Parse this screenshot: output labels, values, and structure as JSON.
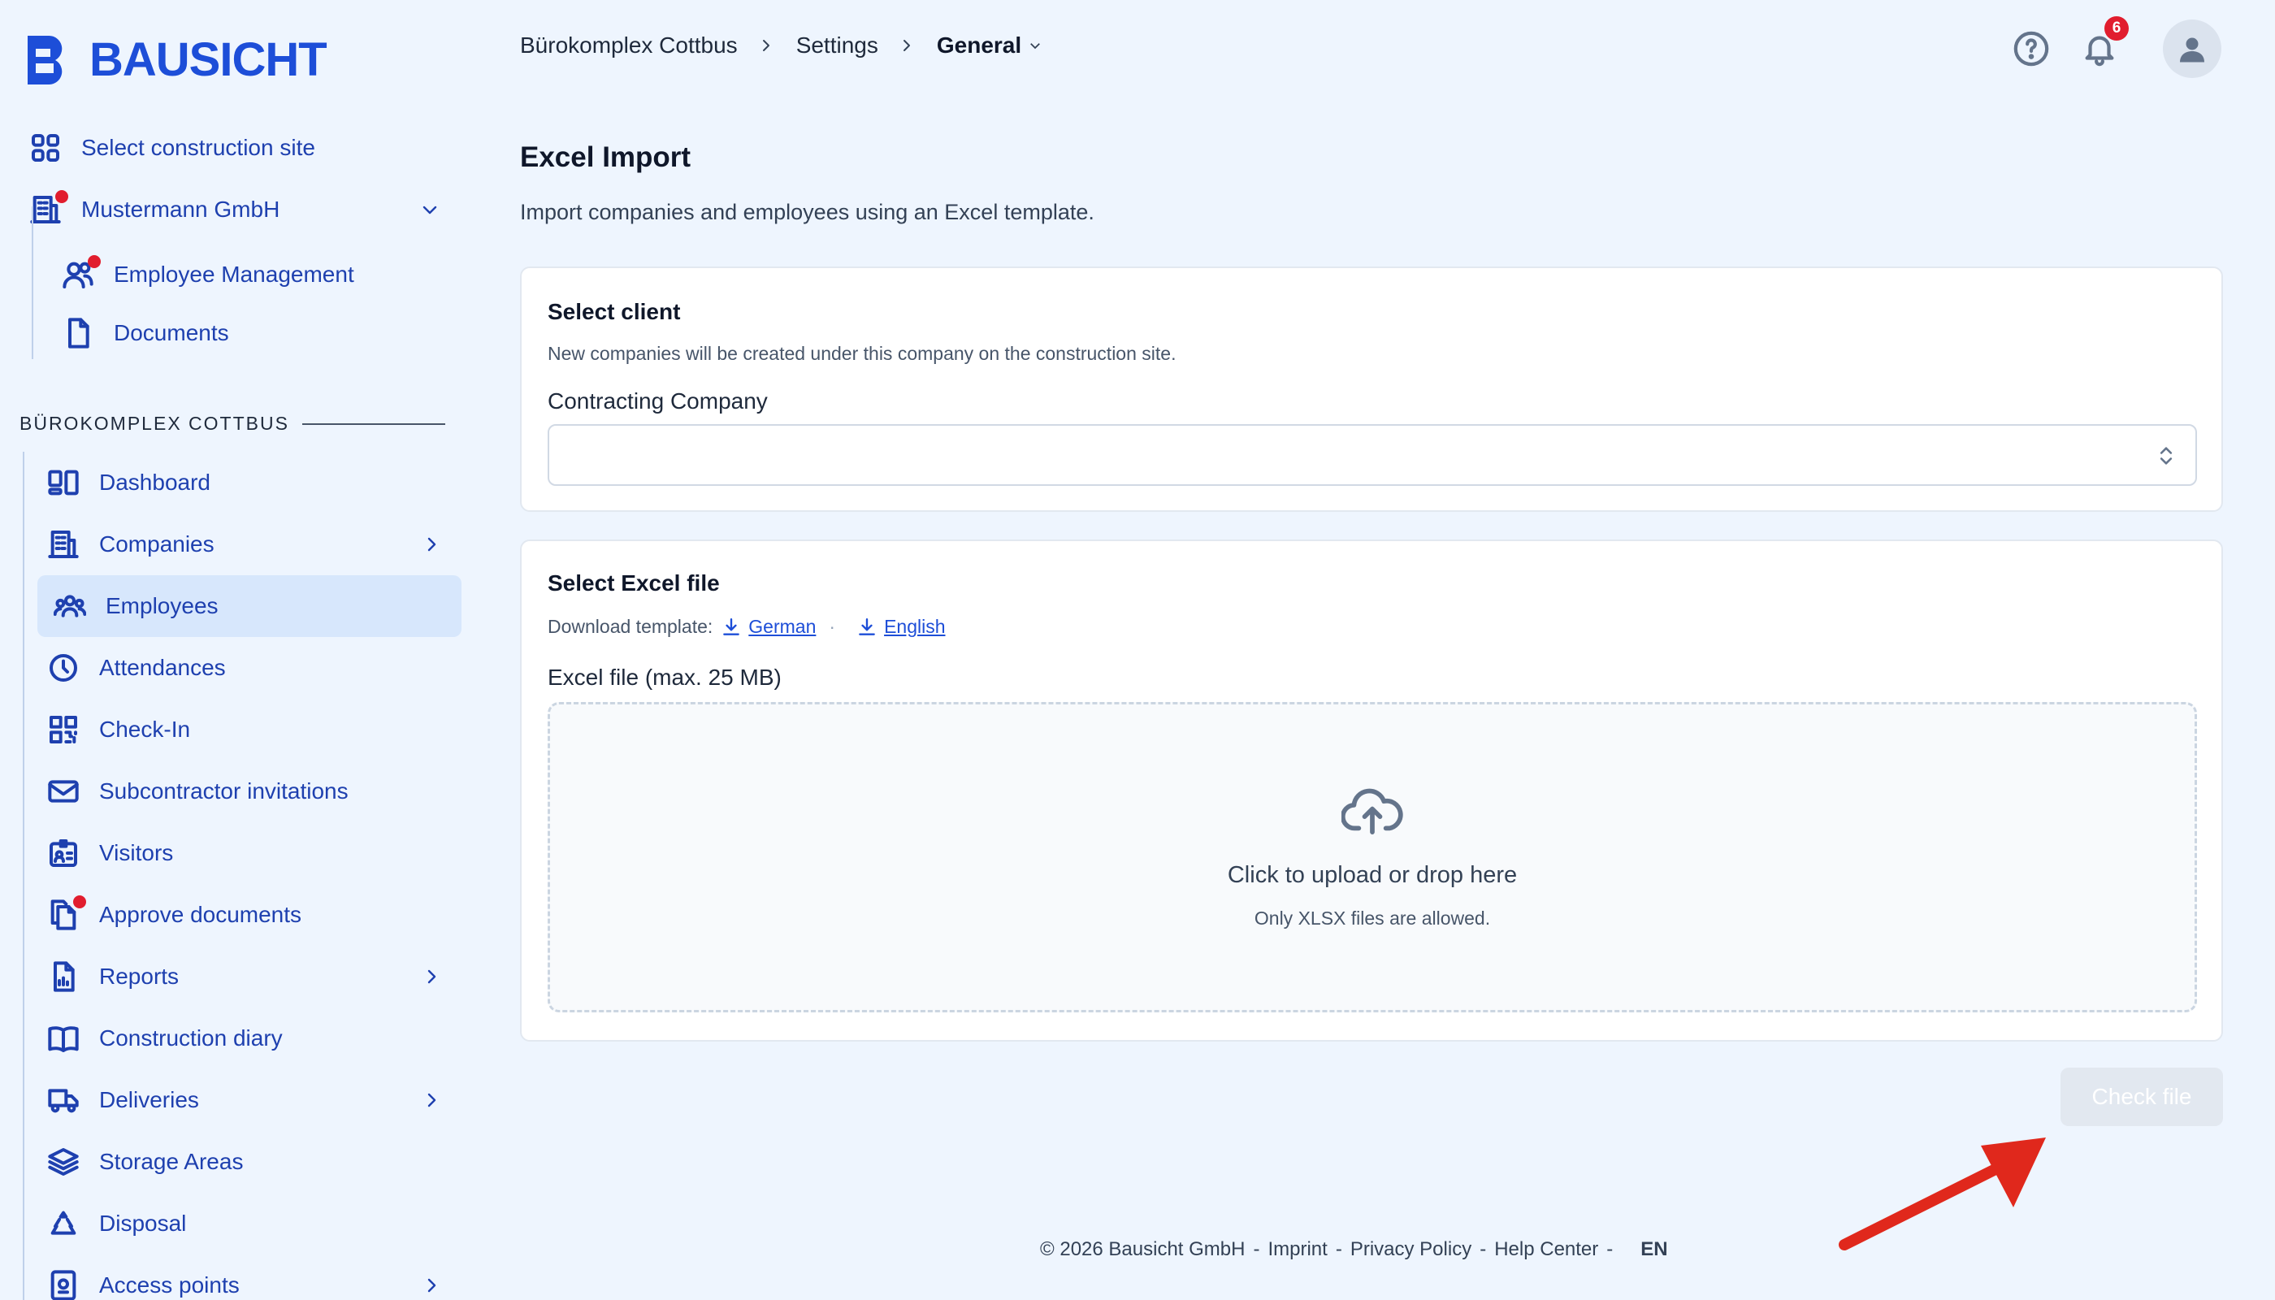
{
  "brand": {
    "name": "BAUSICHT",
    "color": "#1d4ed8"
  },
  "sidebar": {
    "select_site": {
      "label": "Select construction site",
      "icon": "grid-icon"
    },
    "company": {
      "label": "Mustermann GmbH",
      "icon": "building-icon",
      "has_alert": true
    },
    "company_items": [
      {
        "label": "Employee Management",
        "icon": "users-icon",
        "has_alert": true
      },
      {
        "label": "Documents",
        "icon": "document-icon"
      }
    ],
    "section_title": "BÜROKOMPLEX COTTBUS",
    "items": [
      {
        "label": "Dashboard",
        "icon": "dashboard-icon"
      },
      {
        "label": "Companies",
        "icon": "building-icon",
        "has_submenu": true
      },
      {
        "label": "Employees",
        "icon": "team-icon",
        "active": true
      },
      {
        "label": "Attendances",
        "icon": "clock-icon"
      },
      {
        "label": "Check-In",
        "icon": "qr-code-icon"
      },
      {
        "label": "Subcontractor invitations",
        "icon": "envelope-icon"
      },
      {
        "label": "Visitors",
        "icon": "id-card-icon"
      },
      {
        "label": "Approve documents",
        "icon": "documents-icon",
        "has_alert": true
      },
      {
        "label": "Reports",
        "icon": "report-icon",
        "has_submenu": true
      },
      {
        "label": "Construction diary",
        "icon": "book-icon"
      },
      {
        "label": "Deliveries",
        "icon": "truck-icon",
        "has_submenu": true
      },
      {
        "label": "Storage Areas",
        "icon": "layers-icon"
      },
      {
        "label": "Disposal",
        "icon": "recycle-icon"
      },
      {
        "label": "Access points",
        "icon": "access-icon",
        "has_submenu": true
      }
    ]
  },
  "header": {
    "breadcrumb": [
      "Bürokomplex Cottbus",
      "Settings",
      "General"
    ],
    "notifications_count": "6"
  },
  "main": {
    "title": "Excel Import",
    "subtitle": "Import companies and employees using an Excel template.",
    "client_card": {
      "title": "Select client",
      "help": "New companies will be created under this company on the construction site.",
      "field_label": "Contracting Company",
      "selected_value": ""
    },
    "file_card": {
      "title": "Select Excel file",
      "download_label": "Download template:",
      "links": [
        "German",
        "English"
      ],
      "field_label": "Excel file (max. 25 MB)",
      "dropzone_text": "Click to upload or drop here",
      "dropzone_hint": "Only XLSX files are allowed."
    },
    "check_button": "Check file"
  },
  "footer": {
    "copyright": "© 2026 Bausicht GmbH",
    "links": [
      "Imprint",
      "Privacy Policy",
      "Help Center"
    ],
    "language": "EN"
  },
  "colors": {
    "accent": "#1d4ed8",
    "alert": "#e11d2e",
    "annotation_arrow": "#e0281c"
  }
}
